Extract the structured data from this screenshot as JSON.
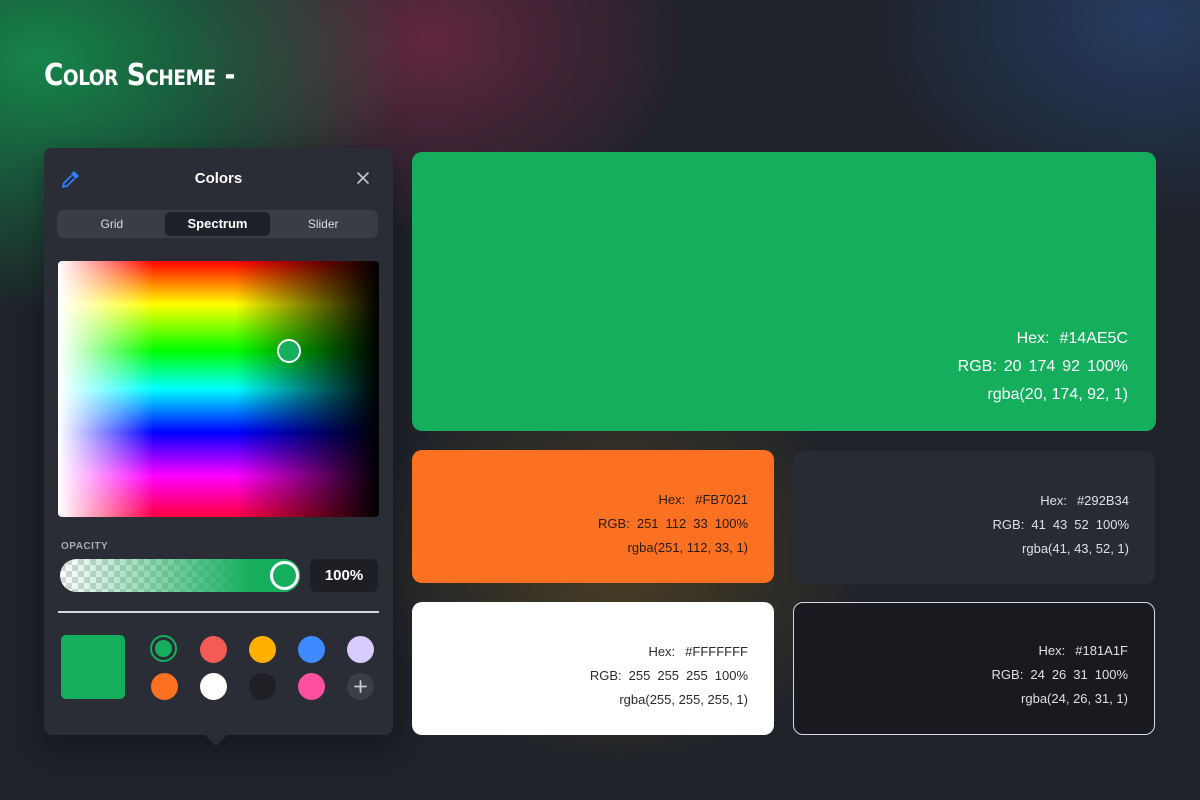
{
  "page": {
    "title": "Color Scheme -"
  },
  "panel": {
    "title": "Colors",
    "tabs": [
      "Grid",
      "Spectrum",
      "Slider"
    ],
    "active_tab": "Spectrum",
    "opacity_label": "OPACITY",
    "opacity_value": "100%",
    "opacity_fraction": 1.0,
    "selected_color": "#14AE5C",
    "icons": {
      "eyedropper": "eyedropper-icon",
      "close": "close-icon",
      "add": "plus-icon"
    },
    "swatches": [
      {
        "color": "#14AE5C",
        "selected": true
      },
      {
        "color": "#F25C54"
      },
      {
        "color": "#FFB000"
      },
      {
        "color": "#3D8BFF"
      },
      {
        "color": "#D8CCFF"
      },
      {
        "color": "#FB7021"
      },
      {
        "color": "#FFFFFF"
      },
      {
        "color": "#1E2026"
      },
      {
        "color": "#FF4FA0"
      }
    ]
  },
  "cards": {
    "green": {
      "hex_label": "Hex:",
      "hex": "#14AE5C",
      "rgb_label": "RGB:",
      "rgb": [
        "20",
        "174",
        "92",
        "100%"
      ],
      "rgba": "rgba(20, 174, 92, 1)"
    },
    "orange": {
      "hex_label": "Hex:",
      "hex": "#FB7021",
      "rgb_label": "RGB:",
      "rgb": [
        "251",
        "112",
        "33",
        "100%"
      ],
      "rgba": "rgba(251, 112, 33, 1)"
    },
    "dark": {
      "hex_label": "Hex:",
      "hex": "#292B34",
      "rgb_label": "RGB:",
      "rgb": [
        "41",
        "43",
        "52",
        "100%"
      ],
      "rgba": "rgba(41, 43, 52, 1)"
    },
    "white": {
      "hex_label": "Hex:",
      "hex": "#FFFFFFF",
      "rgb_label": "RGB:",
      "rgb": [
        "255",
        "255",
        "255",
        "100%"
      ],
      "rgba": "rgba(255, 255, 255, 1)"
    },
    "black": {
      "hex_label": "Hex:",
      "hex": "#181A1F",
      "rgb_label": "RGB:",
      "rgb": [
        "24",
        "26",
        "31",
        "100%"
      ],
      "rgba": "rgba(24, 26, 31, 1)"
    }
  }
}
